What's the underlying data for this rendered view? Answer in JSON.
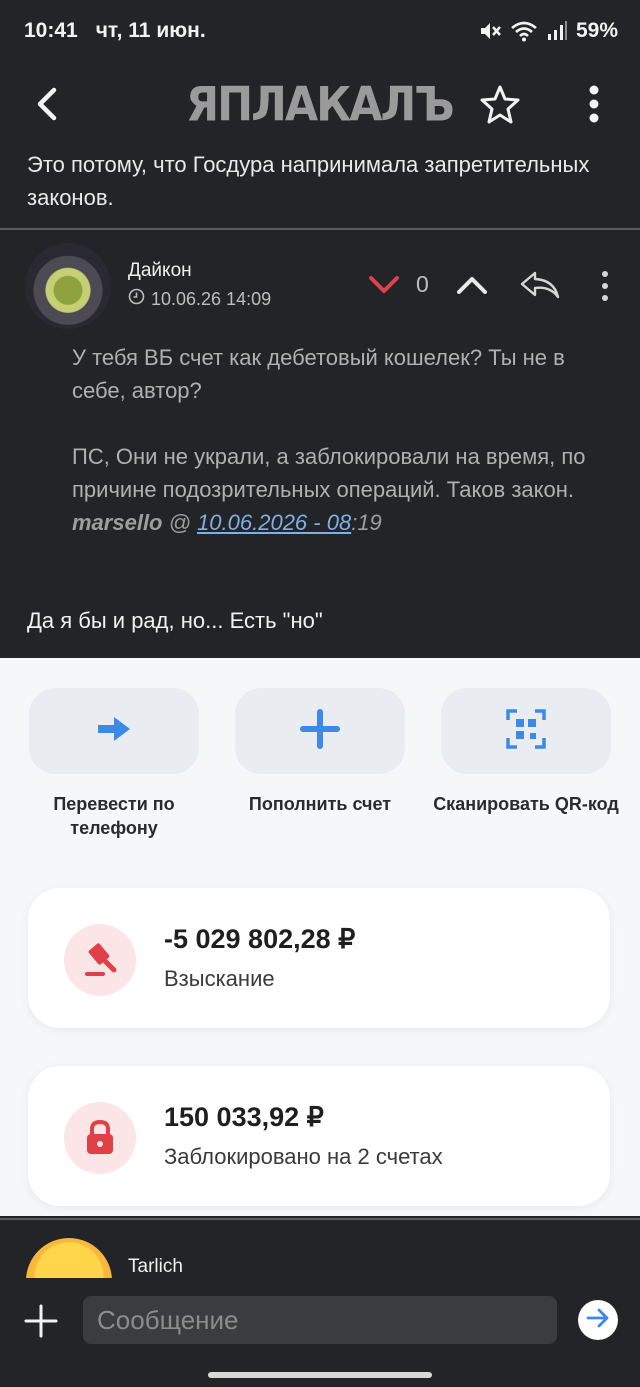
{
  "status_bar": {
    "time": "10:41",
    "date": "чт, 11 июн.",
    "battery": "59%"
  },
  "app_bar": {
    "logo_text": "ЯПЛАКАЛЪ"
  },
  "previous_comment": {
    "text": "Это потому, что Госдура напринимала запретительных законов."
  },
  "comment": {
    "author": "Дайкон",
    "date": "10.06.26 14:09",
    "vote_count": "0",
    "quote_p1": "У тебя ВБ счет как дебетовый кошелек? Ты не в себе, автор?",
    "quote_p2": "ПС, Они не украли, а заблокировали на время, по причине подозрительных операций. Таков закон.",
    "quote_author": "marsello",
    "quote_at": " @ ",
    "quote_link": "10.06.2026 - 08",
    "quote_time_tail": ":19",
    "text": "Да я бы и рад, но... Есть \"но\""
  },
  "screenshot": {
    "actions": [
      {
        "label": "Перевести по телефону",
        "icon": "arrow-right-icon"
      },
      {
        "label": "Пополнить счет",
        "icon": "plus-icon"
      },
      {
        "label": "Сканировать QR-код",
        "icon": "qr-scan-icon"
      }
    ],
    "cards": [
      {
        "amount": "-5 029 802,28 ₽",
        "label": "Взыскание",
        "icon": "gavel-icon"
      },
      {
        "amount": "150 033,92 ₽",
        "label": "Заблокировано на 2 счетах",
        "icon": "lock-icon"
      }
    ],
    "colors": {
      "accent_blue": "#3c8ae8",
      "alert_red": "#e04048"
    }
  },
  "next_comment": {
    "author": "Tarlich"
  },
  "composer": {
    "placeholder": "Сообщение"
  }
}
